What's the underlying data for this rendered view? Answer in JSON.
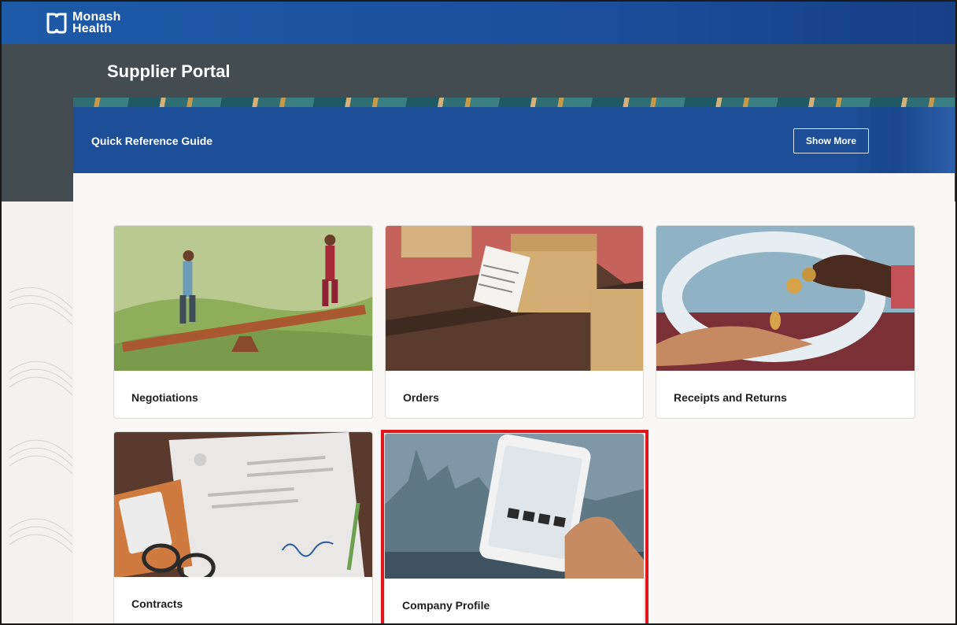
{
  "brand": {
    "line1": "Monash",
    "line2": "Health"
  },
  "header": {
    "title": "Supplier Portal"
  },
  "quick_reference": {
    "title": "Quick Reference Guide",
    "button_label": "Show More"
  },
  "cards": [
    {
      "label": "Negotiations"
    },
    {
      "label": "Orders"
    },
    {
      "label": "Receipts and Returns"
    },
    {
      "label": "Contracts"
    },
    {
      "label": "Company Profile"
    }
  ],
  "colors": {
    "brand_blue": "#1d5aa8",
    "header_dark": "#434c50",
    "qrg_blue": "#1c4f98",
    "highlight_red": "#e0161d"
  }
}
